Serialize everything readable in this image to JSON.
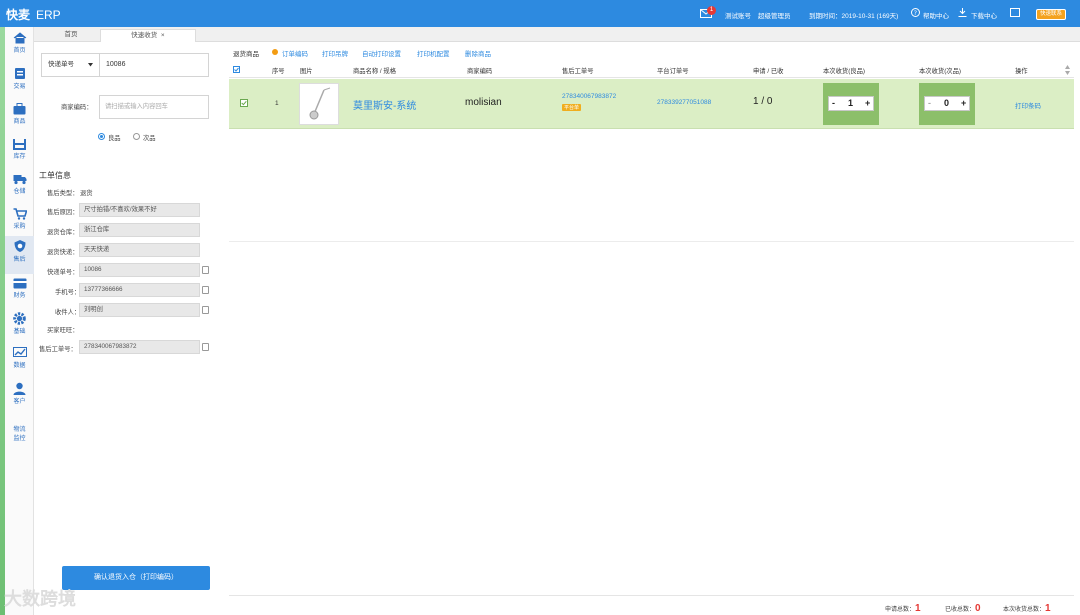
{
  "header": {
    "brand": "快麦",
    "app": "ERP",
    "message_count": "1",
    "account": "测试账号",
    "role": "超级管理员",
    "expiry": "到期时间：2019-10-31 (169天)",
    "help": "帮助中心",
    "download": "下载中心",
    "vip": "快速联系"
  },
  "sidebar": [
    {
      "label": "首页",
      "icon": "home-icon"
    },
    {
      "label": "交易",
      "icon": "trade-icon"
    },
    {
      "label": "商品",
      "icon": "goods-icon"
    },
    {
      "label": "库存",
      "icon": "stock-icon"
    },
    {
      "label": "仓储",
      "icon": "truck-icon"
    },
    {
      "label": "采购",
      "icon": "cart-icon"
    },
    {
      "label": "售后",
      "icon": "aftersale-icon"
    },
    {
      "label": "财务",
      "icon": "finance-icon"
    },
    {
      "label": "基础",
      "icon": "gear-icon"
    },
    {
      "label": "数据",
      "icon": "chart-icon"
    },
    {
      "label": "客户",
      "icon": "user-icon"
    },
    {
      "label": "物流\n监控",
      "icon": ""
    }
  ],
  "tabs": {
    "home": "首页",
    "active": "快速收货",
    "close": "×"
  },
  "left": {
    "express_select": "快递单号",
    "express_value": "10086",
    "merchant_label": "商家编码：",
    "merchant_placeholder": "请扫描或输入内容回车",
    "radio_good": "良品",
    "radio_bad": "次品",
    "section_title": "工单信息",
    "aftersale_type_label": "售后类型：",
    "aftersale_type_value": "退货",
    "reason_label": "售后原因：",
    "reason_value": "尺寸拍错/不喜欢/效果不好",
    "warehouse_label": "退货仓库：",
    "warehouse_value": "浙江仓库",
    "express_co_label": "退货快递：",
    "express_co_value": "天天快递",
    "express_no_label": "快递单号：",
    "express_no_value": "10086",
    "phone_label": "手机号：",
    "phone_value": "13777366666",
    "receiver_label": "收件人：",
    "receiver_value": "刘明创",
    "buyer_label": "买家旺旺：",
    "ticket_label": "售后工单号：",
    "ticket_value": "278340067983872",
    "confirm": "确认退货入仓（打印编码）"
  },
  "toolbar": {
    "title": "退货商品",
    "print_code": "订单编码",
    "print_tag": "打印吊牌",
    "auto_print": "自动打印设置",
    "printer": "打印机配置",
    "delete": "删除商品"
  },
  "table": {
    "headers": [
      "序号",
      "图片",
      "商品名称 / 规格",
      "商家编码",
      "售后工单号",
      "平台订单号",
      "申请 / 已收",
      "本次收货(良品)",
      "本次收货(次品)",
      "操作"
    ],
    "row": {
      "index": "1",
      "name": "莫里斯安-系统",
      "code": "molisian",
      "ticket": "278340067983872",
      "ticket_tag": "平台单",
      "platform_order": "278339277051088",
      "apply_received": "1 / 0",
      "good_qty": "1",
      "bad_qty": "0",
      "action": "打印条码",
      "minus": "-",
      "plus": "+"
    }
  },
  "footer": {
    "apply_label": "申请总数：",
    "apply_total": "1",
    "received_label": "已收总数：",
    "received_total": "0",
    "this_label": "本次收货总数：",
    "this_total": "1"
  },
  "watermark": "大数跨境"
}
